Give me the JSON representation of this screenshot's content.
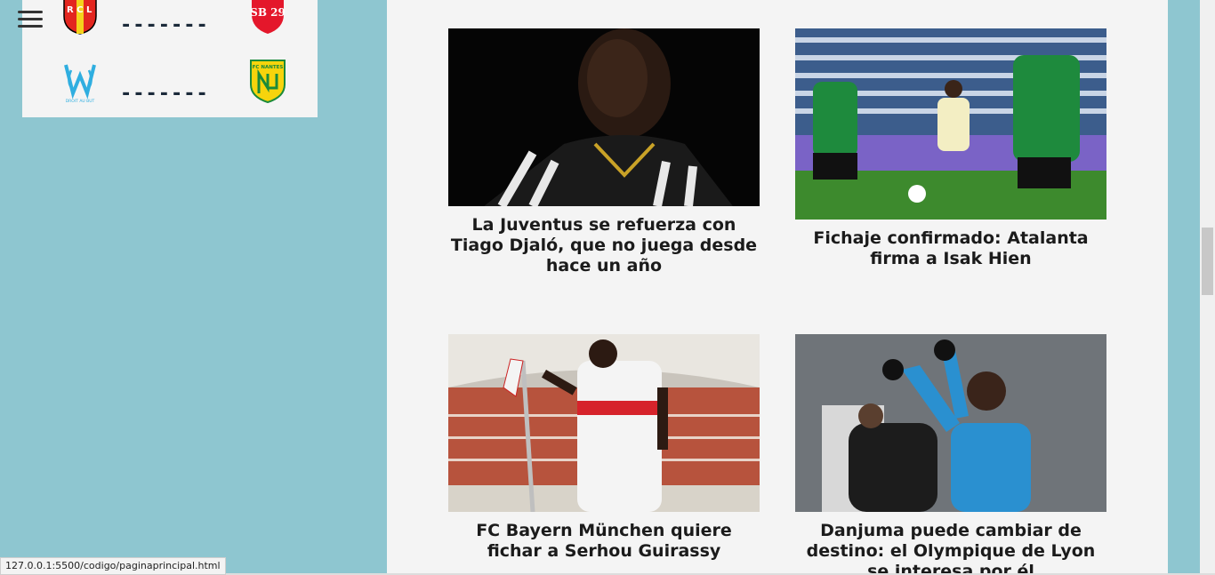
{
  "nav": {
    "menu_icon": "hamburger-menu-icon"
  },
  "fixtures": [
    {
      "home": "RC Lens",
      "home_crest_text": "R C L",
      "away": "Stade Brestois 29",
      "away_crest_text": "SB 29",
      "separator": "-------"
    },
    {
      "home": "Olympique de Marseille",
      "home_crest_text": "DROIT AU BUT",
      "away": "FC Nantes",
      "away_crest_text": "FC NANTES",
      "separator": "-------"
    }
  ],
  "news": [
    {
      "title": "La Juventus se refuerza con Tiago Djaló, que no juega desde hace un año"
    },
    {
      "title": "Fichaje confirmado: Atalanta firma a Isak Hien"
    },
    {
      "title": "FC Bayern München quiere fichar a Serhou Guirassy"
    },
    {
      "title": "Danjuma puede cambiar de destino: el Olympique de Lyon se interesa por él"
    }
  ],
  "status_bar": {
    "url": "127.0.0.1:5500/codigo/paginaprincipal.html"
  },
  "colors": {
    "page_bg": "#8ec6d0",
    "content_bg": "#f4f4f4",
    "title_text": "#1b1b1b",
    "separator": "#1b2a3a"
  }
}
